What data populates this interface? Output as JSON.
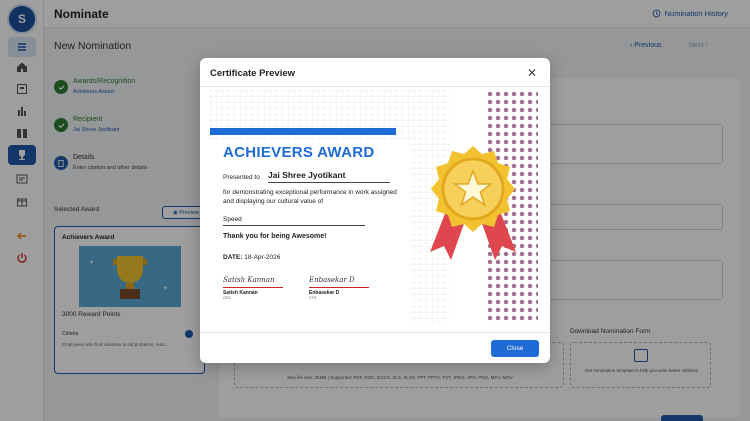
{
  "sidebar": {
    "logo_letter": "S",
    "items": [
      "menu-icon",
      "home-icon",
      "id-card-icon",
      "bar-chart-icon",
      "book-icon",
      "trophy-icon",
      "list-icon",
      "gift-icon",
      "arrow-left-icon",
      "power-icon"
    ]
  },
  "header": {
    "title": "Nominate",
    "history_label": "Nomination History"
  },
  "page": {
    "title": "New Nomination",
    "previous": "Previous",
    "next": "Next"
  },
  "steps": [
    {
      "label": "Awards/Recognition",
      "sub": "Achievers Award"
    },
    {
      "label": "Recipient",
      "sub": "Jai Shree Jyotikant"
    },
    {
      "label": "Details",
      "sub": "Enter citation and other details"
    }
  ],
  "selected_award": {
    "section_label": "Selected Award",
    "preview_label": "Preview",
    "name": "Achievers Award",
    "points": "3000 Reward Points",
    "criteria_label": "Criteria",
    "criteria_text": "Employees who find solutions to old problems, redu..."
  },
  "upload": {
    "hint": "Max file size: 25MB | Supported: PDF, DOC, DOCX, XLS, XLSX, PPT, PPTX, TXT, JPEG, JPG, PNG, MP4, MOV"
  },
  "download_form": {
    "title": "Download Nomination Form",
    "text": "Get nomination template to help you write better citations"
  },
  "modal": {
    "title": "Certificate Preview",
    "close_label": "Close",
    "certificate": {
      "heading": "ACHIEVERS AWARD",
      "presented_to": "Presented to",
      "recipient": "Jai Shree Jyotikant",
      "description": "for demonstrating exceptional performance in work assigned and displaying our cultural value of",
      "value": "Speed",
      "thanks": "Thank you for being Awesome!",
      "date_label": "DATE:",
      "date": "18-Apr-2026",
      "signatories": [
        {
          "signature": "Satish Kannan",
          "name": "Satish Kannan",
          "role": "CEO"
        },
        {
          "signature": "Enbasekar D",
          "name": "Enbasekar D",
          "role": "CTO"
        }
      ]
    }
  },
  "colors": {
    "primary": "#1e5aa8",
    "certificate_blue": "#1e6bd6",
    "success": "#2e7d32",
    "ribbon_red": "#e0464e",
    "medal_gold": "#f2c230"
  }
}
